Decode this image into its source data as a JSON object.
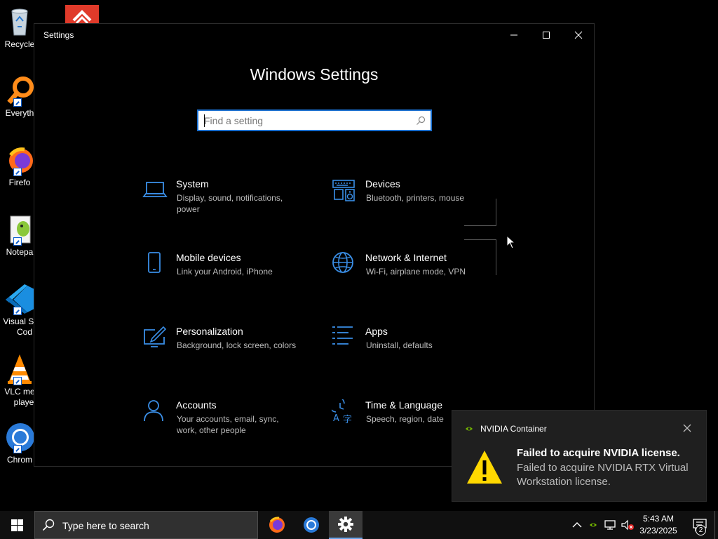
{
  "desktop": {
    "icons": [
      {
        "label": "Recycle"
      },
      {
        "label": "Everyth"
      },
      {
        "label": "Firefo"
      },
      {
        "label": "Notepa"
      },
      {
        "label": "Visual St",
        "label2": "Cod"
      },
      {
        "label": "VLC me",
        "label2": "playe"
      },
      {
        "label": "Chrom"
      }
    ]
  },
  "window": {
    "title": "Settings",
    "heading": "Windows Settings",
    "search_placeholder": "Find a setting"
  },
  "tiles": [
    {
      "title": "System",
      "desc": "Display, sound, notifications, power"
    },
    {
      "title": "Devices",
      "desc": "Bluetooth, printers, mouse"
    },
    {
      "title": "Mobile devices",
      "desc": "Link your Android, iPhone"
    },
    {
      "title": "Network & Internet",
      "desc": "Wi-Fi, airplane mode, VPN"
    },
    {
      "title": "Personalization",
      "desc": "Background, lock screen, colors"
    },
    {
      "title": "Apps",
      "desc": "Uninstall, defaults"
    },
    {
      "title": "Accounts",
      "desc": "Your accounts, email, sync, work, other people"
    },
    {
      "title": "Time & Language",
      "desc": "Speech, region, date"
    }
  ],
  "toast": {
    "app_name": "NVIDIA Container",
    "heading": "Failed to acquire NVIDIA license.",
    "body": "Failed to acquire NVIDIA RTX Virtual Workstation license."
  },
  "taskbar": {
    "search_placeholder": "Type here to search",
    "time": "5:43 AM",
    "date": "3/23/2025",
    "notification_count": "2"
  },
  "colors": {
    "accent": "#0078d7",
    "icon_blue": "#3a8ee6",
    "warning_yellow": "#ffd800",
    "nvidia_green": "#76b900"
  }
}
